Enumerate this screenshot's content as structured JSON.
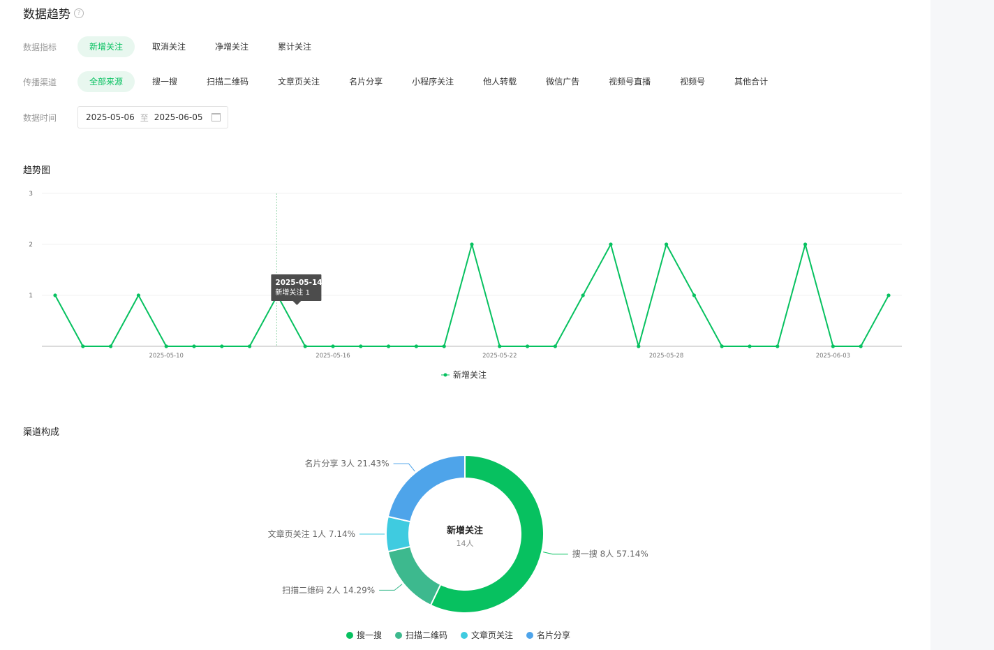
{
  "page": {
    "title": "数据趋势"
  },
  "filters": {
    "metric": {
      "label": "数据指标",
      "options": [
        "新增关注",
        "取消关注",
        "净增关注",
        "累计关注"
      ],
      "active": 0
    },
    "channel": {
      "label": "传播渠道",
      "options": [
        "全部来源",
        "搜一搜",
        "扫描二维码",
        "文章页关注",
        "名片分享",
        "小程序关注",
        "他人转载",
        "微信广告",
        "视频号直播",
        "视频号",
        "其他合计"
      ],
      "active": 0
    },
    "time": {
      "label": "数据时间",
      "start": "2025-05-06",
      "separator": "至",
      "end": "2025-06-05"
    }
  },
  "sections": {
    "trend": "趋势图",
    "composition": "渠道构成"
  },
  "colors": {
    "accent": "#07c160",
    "search": "#07c160",
    "qrcode": "#3db98e",
    "article": "#3fcbe0",
    "card": "#4ea4ea"
  },
  "tooltip": {
    "date": "2025-05-14",
    "label": "新增关注",
    "value": "1"
  },
  "chart_data": [
    {
      "type": "line",
      "x": [
        "2025-05-06",
        "2025-05-07",
        "2025-05-08",
        "2025-05-09",
        "2025-05-10",
        "2025-05-11",
        "2025-05-12",
        "2025-05-13",
        "2025-05-14",
        "2025-05-15",
        "2025-05-16",
        "2025-05-17",
        "2025-05-18",
        "2025-05-19",
        "2025-05-20",
        "2025-05-21",
        "2025-05-22",
        "2025-05-23",
        "2025-05-24",
        "2025-05-25",
        "2025-05-26",
        "2025-05-27",
        "2025-05-28",
        "2025-05-29",
        "2025-05-30",
        "2025-05-31",
        "2025-06-01",
        "2025-06-02",
        "2025-06-03",
        "2025-06-04",
        "2025-06-05"
      ],
      "series": [
        {
          "name": "新增关注",
          "values": [
            1,
            0,
            0,
            1,
            0,
            0,
            0,
            0,
            1,
            0,
            0,
            0,
            0,
            0,
            0,
            2,
            0,
            0,
            0,
            1,
            2,
            0,
            2,
            1,
            0,
            0,
            0,
            2,
            0,
            0,
            1
          ]
        }
      ],
      "x_ticks": [
        "2025-05-10",
        "2025-05-16",
        "2025-05-22",
        "2025-05-28",
        "2025-06-03"
      ],
      "y_ticks": [
        1,
        2,
        3
      ],
      "ylim": [
        0,
        3
      ],
      "grid": true,
      "legend": "bottom-center"
    },
    {
      "type": "pie",
      "center_title": "新增关注",
      "center_subtitle": "14人",
      "slices": [
        {
          "name": "搜一搜",
          "count": "8人",
          "value": 8,
          "percent": "57.14%"
        },
        {
          "name": "扫描二维码",
          "count": "2人",
          "value": 2,
          "percent": "14.29%"
        },
        {
          "name": "文章页关注",
          "count": "1人",
          "value": 1,
          "percent": "7.14%"
        },
        {
          "name": "名片分享",
          "count": "3人",
          "value": 3,
          "percent": "21.43%"
        }
      ],
      "legend": "bottom-center"
    }
  ]
}
